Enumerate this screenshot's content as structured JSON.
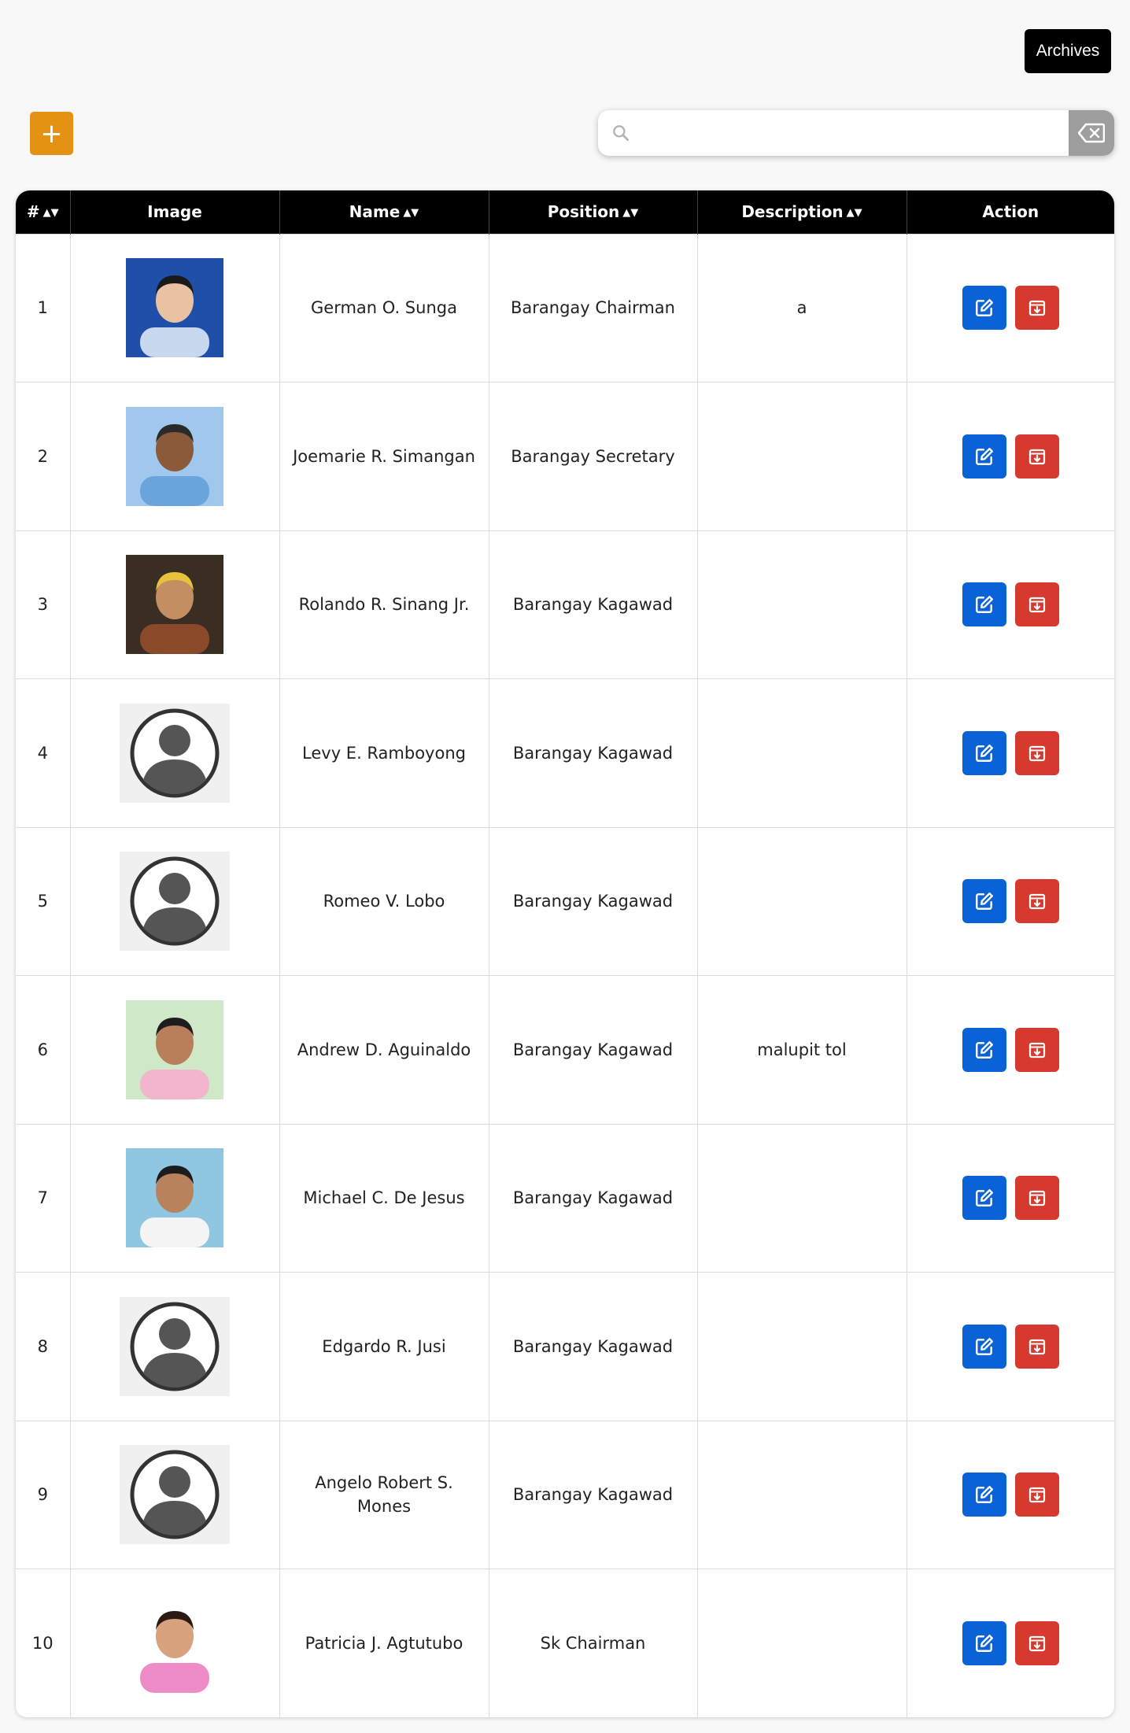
{
  "toolbar": {
    "archives_label": "Archives",
    "add_label": "+",
    "search_value": "",
    "search_placeholder": ""
  },
  "table": {
    "columns": [
      "#",
      "Image",
      "Name",
      "Position",
      "Description",
      "Action"
    ],
    "rows": [
      {
        "num": "1",
        "name": "German O. Sunga",
        "position": "Barangay Chairman",
        "description": "a",
        "image": "photo"
      },
      {
        "num": "2",
        "name": "Joemarie R. Simangan",
        "position": "Barangay Secretary",
        "description": "",
        "image": "photo"
      },
      {
        "num": "3",
        "name": "Rolando R. Sinang Jr.",
        "position": "Barangay Kagawad",
        "description": "",
        "image": "photo"
      },
      {
        "num": "4",
        "name": "Levy E. Ramboyong",
        "position": "Barangay Kagawad",
        "description": "",
        "image": "placeholder"
      },
      {
        "num": "5",
        "name": "Romeo V. Lobo",
        "position": "Barangay Kagawad",
        "description": "",
        "image": "placeholder"
      },
      {
        "num": "6",
        "name": "Andrew D. Aguinaldo",
        "position": "Barangay Kagawad",
        "description": "malupit tol",
        "image": "photo"
      },
      {
        "num": "7",
        "name": "Michael C. De Jesus",
        "position": "Barangay Kagawad",
        "description": "",
        "image": "photo"
      },
      {
        "num": "8",
        "name": "Edgardo R. Jusi",
        "position": "Barangay Kagawad",
        "description": "",
        "image": "placeholder"
      },
      {
        "num": "9",
        "name": "Angelo Robert S. Mones",
        "position": "Barangay Kagawad",
        "description": "",
        "image": "placeholder"
      },
      {
        "num": "10",
        "name": "Patricia J. Agtutubo",
        "position": "Sk Chairman",
        "description": "",
        "image": "photo"
      }
    ]
  },
  "colors": {
    "add_button": "#e39212",
    "edit_button": "#0a63d6",
    "archive_button": "#d63a2e",
    "header_bg": "#000000"
  },
  "icons": {
    "search": "search-icon",
    "clear": "backspace-icon",
    "edit": "edit-icon",
    "archive": "archive-icon",
    "sort": "sort-icon"
  }
}
